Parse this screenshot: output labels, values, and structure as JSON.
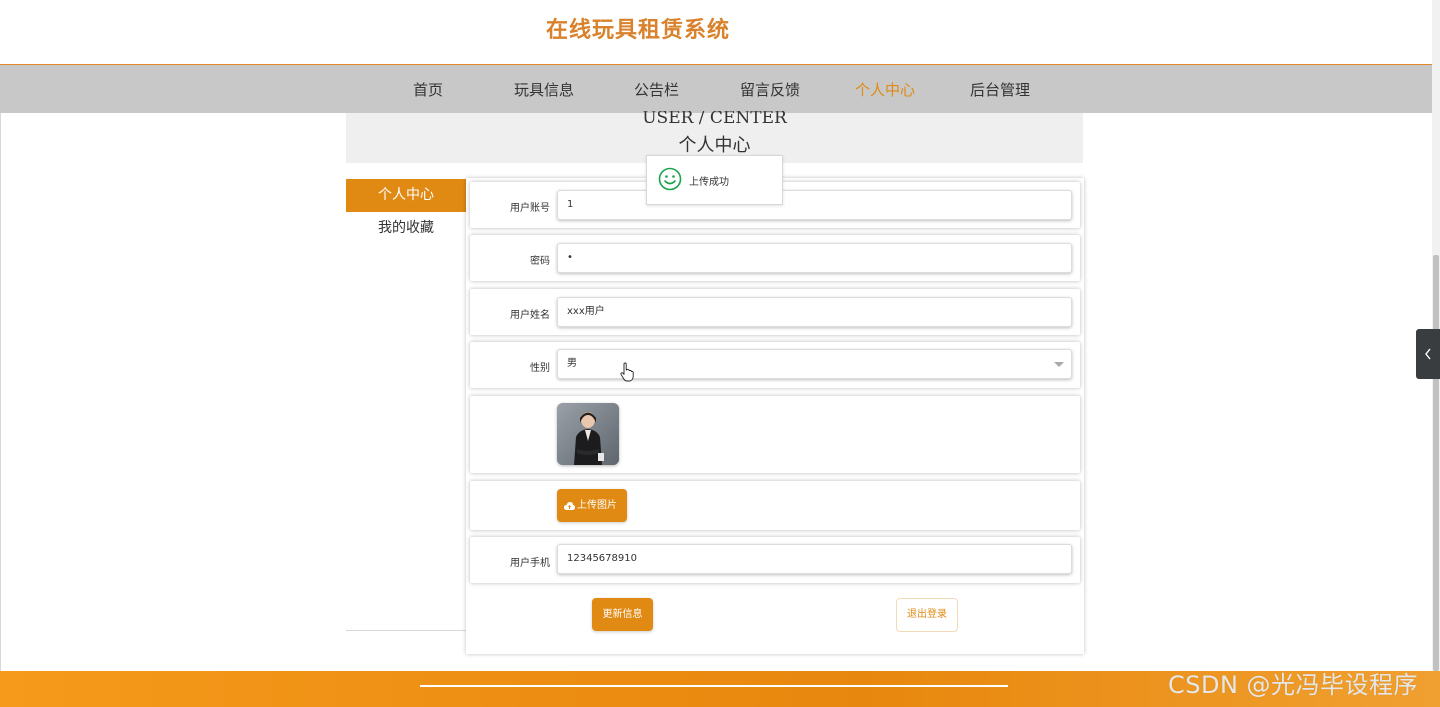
{
  "header": {
    "title": "在线玩具租赁系统"
  },
  "nav": {
    "items": [
      {
        "label": "首页"
      },
      {
        "label": "玩具信息"
      },
      {
        "label": "公告栏"
      },
      {
        "label": "留言反馈"
      },
      {
        "label": "个人中心",
        "active": true
      },
      {
        "label": "后台管理"
      }
    ]
  },
  "banner": {
    "en": "USER / CENTER",
    "cn": "个人中心"
  },
  "side_menu": {
    "items": [
      {
        "label": "个人中心",
        "active": true
      },
      {
        "label": "我的收藏"
      }
    ]
  },
  "form": {
    "account": {
      "label": "用户账号",
      "value": "1"
    },
    "password": {
      "label": "密码",
      "value": "•"
    },
    "name": {
      "label": "用户姓名",
      "value": "xxx用户"
    },
    "gender": {
      "label": "性别",
      "value": "男"
    },
    "upload_label": "上传图片",
    "phone": {
      "label": "用户手机",
      "value": "12345678910"
    },
    "update_label": "更新信息",
    "logout_label": "退出登录"
  },
  "toast": {
    "text": "上传成功",
    "color": "#1aa34a"
  },
  "watermark": "CSDN @光冯毕设程序",
  "colors": {
    "accent": "#e08a13",
    "title": "#d9822b",
    "nav_bg": "#c8c8c8"
  }
}
